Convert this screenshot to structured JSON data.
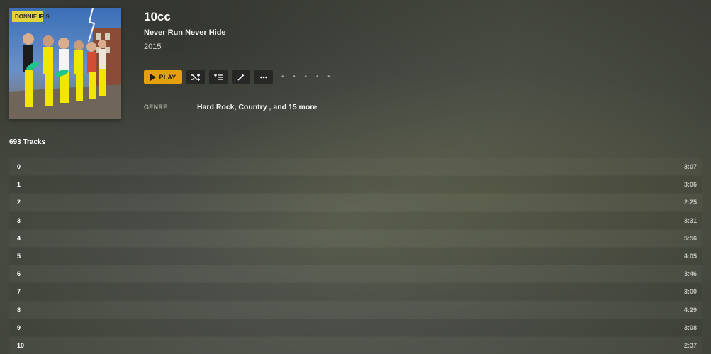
{
  "album": {
    "artist": "10cc",
    "title": "Never Run Never Hide",
    "year": "2015",
    "art_text": "DONNIE IRIS",
    "art_alt": "album-cover"
  },
  "actions": {
    "play_label": "PLAY",
    "play_icon": "play-icon",
    "shuffle_icon": "shuffle-icon",
    "add_to_queue_icon": "add-to-queue-icon",
    "edit_icon": "edit-icon",
    "more_icon": "more-icon",
    "extra_dots": "• • • • •"
  },
  "genre": {
    "label": "GENRE",
    "value": "Hard Rock, Country , and 15 more"
  },
  "tracks": {
    "count_label": "693 Tracks",
    "items": [
      {
        "title": "0",
        "duration": "3:07"
      },
      {
        "title": "1",
        "duration": "3:06"
      },
      {
        "title": "2",
        "duration": "2:25"
      },
      {
        "title": "3",
        "duration": "3:31"
      },
      {
        "title": "4",
        "duration": "5:56"
      },
      {
        "title": "5",
        "duration": "4:05"
      },
      {
        "title": "6",
        "duration": "3:46"
      },
      {
        "title": "7",
        "duration": "3:00"
      },
      {
        "title": "8",
        "duration": "4:29"
      },
      {
        "title": "9",
        "duration": "3:08"
      },
      {
        "title": "10",
        "duration": "2:37"
      }
    ]
  },
  "colors": {
    "accent": "#e5a00d",
    "button_bg": "#1e1e1e",
    "muted_text": "#a9aaa1"
  }
}
